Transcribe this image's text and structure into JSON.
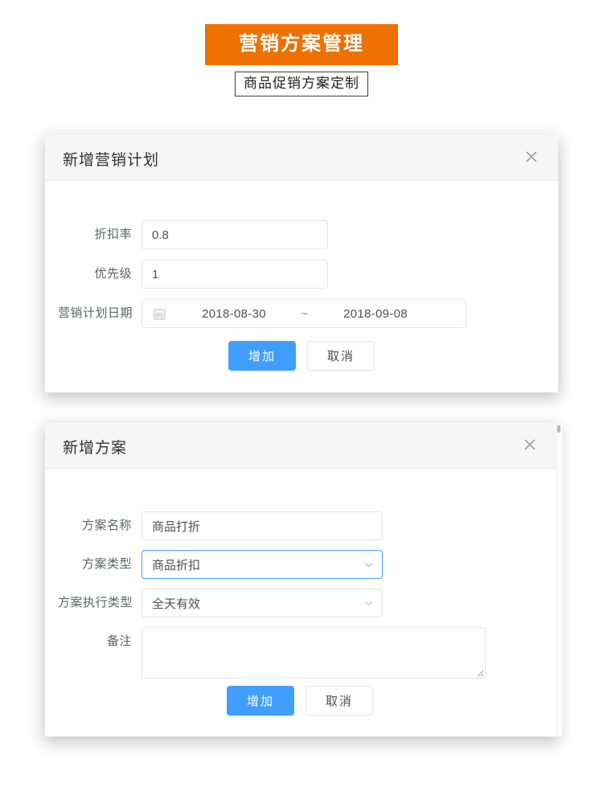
{
  "header": {
    "banner_title": "营销方案管理",
    "subtitle": "商品促销方案定制"
  },
  "colors": {
    "banner_bg": "#ee7100",
    "primary_button": "#409eff",
    "focus_border": "#409eff",
    "label_text": "#5e6165",
    "card_header_bg": "#f6f6f7"
  },
  "plan_dialog": {
    "title": "新增营销计划",
    "close_icon": "close-icon",
    "fields": {
      "discount": {
        "label": "折扣率",
        "value": "0.8"
      },
      "priority": {
        "label": "优先级",
        "value": "1"
      },
      "date_range": {
        "label": "营销计划日期",
        "icon": "calendar-icon",
        "start": "2018-08-30",
        "separator": "~",
        "end": "2018-09-08"
      }
    },
    "buttons": {
      "submit": "增加",
      "cancel": "取消"
    }
  },
  "scheme_dialog": {
    "title": "新增方案",
    "close_icon": "close-icon",
    "fields": {
      "scheme_name": {
        "label": "方案名称",
        "value": "商品打折"
      },
      "scheme_type": {
        "label": "方案类型",
        "value": "商品折扣",
        "icon": "chevron-down-icon",
        "focused": true
      },
      "execute_type": {
        "label": "方案执行类型",
        "value": "全天有效",
        "icon": "chevron-down-icon",
        "focused": false
      },
      "remark": {
        "label": "备注",
        "value": "",
        "placeholder": ""
      }
    },
    "buttons": {
      "submit": "增加",
      "cancel": "取消"
    }
  }
}
